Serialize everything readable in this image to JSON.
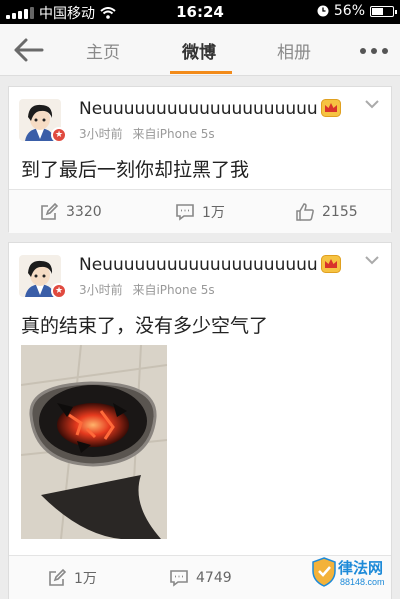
{
  "status_bar": {
    "carrier": "中国移动",
    "time": "16:24",
    "battery": "56%",
    "battery_level": 0.56
  },
  "nav": {
    "tabs": [
      {
        "label": "主页"
      },
      {
        "label": "微博"
      },
      {
        "label": "相册"
      }
    ],
    "active_tab": "微博"
  },
  "posts": [
    {
      "username": "Neuuuuuuuuuuuuuuuuuuuu...",
      "time": "3小时前",
      "source": "来自iPhone 5s",
      "text": "到了最后一刻你却拉黑了我",
      "repost_count": "3320",
      "comment_count": "1万",
      "like_count": "2155"
    },
    {
      "username": "Neuuuuuuuuuuuuuuuuuuuu...",
      "time": "3小时前",
      "source": "来自iPhone 5s",
      "text": "真的结束了，没有多少空气了",
      "repost_count": "1万",
      "comment_count": "4749"
    }
  ],
  "watermark": {
    "brand": "律法网",
    "domain": "88148.com"
  },
  "colors": {
    "accent": "#f28b1a",
    "badge": "#e04a3f",
    "watermark": "#1d8ad8"
  }
}
